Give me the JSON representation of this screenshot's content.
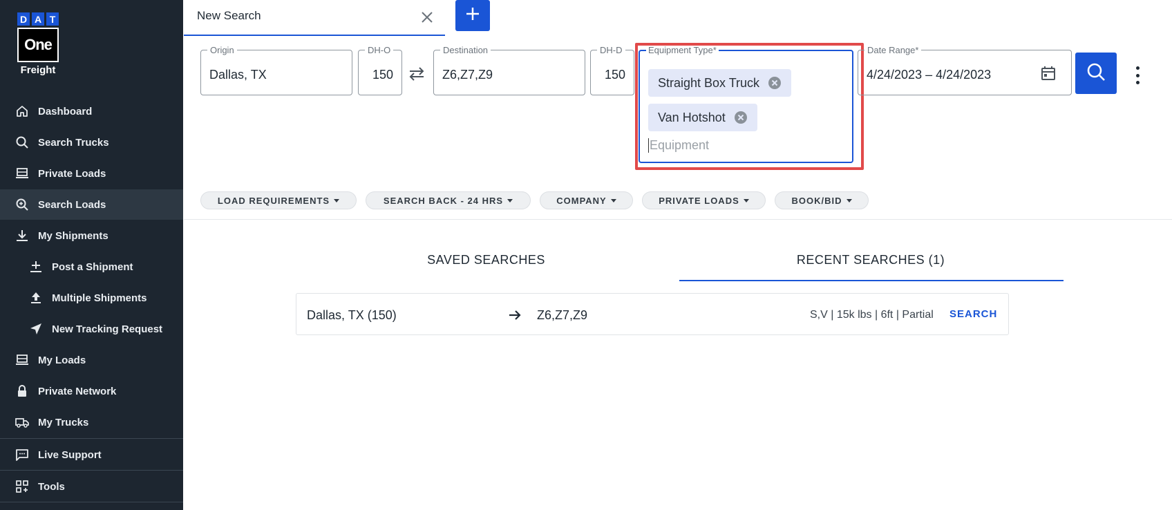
{
  "brand": {
    "dat_letters": [
      "D",
      "A",
      "T"
    ],
    "one": "One",
    "freight": "Freight"
  },
  "sidebar": {
    "items": [
      {
        "label": "Dashboard",
        "icon": "home-icon"
      },
      {
        "label": "Search Trucks",
        "icon": "search-icon"
      },
      {
        "label": "Private Loads",
        "icon": "truck-icon"
      },
      {
        "label": "Search Loads",
        "icon": "search-plus-icon",
        "active": true
      },
      {
        "label": "My Shipments",
        "icon": "download-icon"
      },
      {
        "label": "Post a Shipment",
        "icon": "plus-icon"
      },
      {
        "label": "Multiple Shipments",
        "icon": "upload-icon"
      },
      {
        "label": "New Tracking Request",
        "icon": "navigation-icon"
      },
      {
        "label": "My Loads",
        "icon": "truck-icon"
      },
      {
        "label": "Private Network",
        "icon": "lock-icon"
      },
      {
        "label": "My Trucks",
        "icon": "truck-outline-icon"
      },
      {
        "label": "Live Support",
        "icon": "chat-icon"
      },
      {
        "label": "Tools",
        "icon": "grid-icon"
      }
    ]
  },
  "tab": {
    "label": "New Search"
  },
  "search": {
    "origin": {
      "label": "Origin",
      "value": "Dallas, TX"
    },
    "dh_o": {
      "label": "DH-O",
      "value": "150"
    },
    "destination": {
      "label": "Destination",
      "value": "Z6,Z7,Z9"
    },
    "dh_d": {
      "label": "DH-D",
      "value": "150"
    },
    "equipment": {
      "label": "Equipment Type*",
      "chips": [
        "Straight Box Truck",
        "Van Hotshot"
      ],
      "placeholder": "Equipment"
    },
    "date_range": {
      "label": "Date Range*",
      "value": "4/24/2023 – 4/24/2023"
    }
  },
  "filters": [
    "LOAD REQUIREMENTS",
    "SEARCH BACK - 24 HRS",
    "COMPANY",
    "PRIVATE LOADS",
    "BOOK/BID"
  ],
  "searches_tabs": {
    "saved": "SAVED SEARCHES",
    "recent": "RECENT SEARCHES (1)"
  },
  "recent": {
    "origin": "Dallas, TX (150)",
    "destination": "Z6,Z7,Z9",
    "details": "S,V | 15k lbs | 6ft | Partial",
    "action": "SEARCH"
  },
  "colors": {
    "sidebar_bg": "#1d2630",
    "accent": "#1a55d6",
    "highlight": "#e14a4a",
    "chip_bg": "#e3e8f8"
  }
}
